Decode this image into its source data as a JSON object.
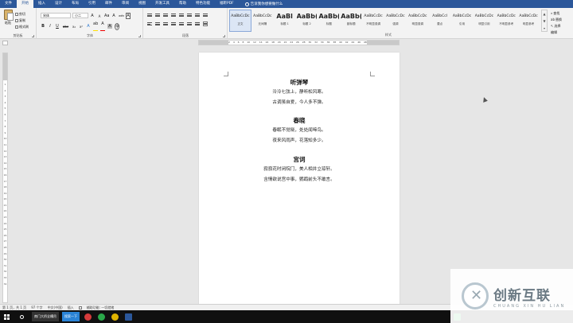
{
  "tabs": [
    "文件",
    "开始",
    "插入",
    "设计",
    "布局",
    "引用",
    "邮件",
    "审阅",
    "视图",
    "开发工具",
    "帮助",
    "特色功能",
    "福昕PDF"
  ],
  "active_tab": "开始",
  "tell_me": "告诉我你想要做什么",
  "clipboard": {
    "paste": "粘贴",
    "cut": "剪切",
    "copy": "复制",
    "format_painter": "格式刷",
    "label": "剪贴板"
  },
  "font": {
    "name": "宋体",
    "size": "小二",
    "grow": "A",
    "shrink": "A",
    "case": "Aa",
    "clear": "A",
    "phonetic": "wén",
    "border": "A",
    "bold": "B",
    "italic": "I",
    "underline": "U",
    "strike": "abc",
    "sub": "x₂",
    "sup": "x²",
    "effects": "A",
    "highlight": "ab",
    "color": "A",
    "char_shade": "A",
    "enclose": "字",
    "label": "字体"
  },
  "paragraph": {
    "label": "段落"
  },
  "styles": {
    "label": "样式",
    "items": [
      {
        "preview": "AaBbCcDc",
        "name": "正文",
        "selected": true
      },
      {
        "preview": "AaBbCcDc",
        "name": "无间隔",
        "selected": false
      },
      {
        "preview": "AaBl",
        "name": "标题 1",
        "selected": false
      },
      {
        "preview": "AaBb(",
        "name": "标题 2",
        "selected": false
      },
      {
        "preview": "AaBb(",
        "name": "标题",
        "selected": false
      },
      {
        "preview": "AaBb(",
        "name": "副标题",
        "selected": false
      },
      {
        "preview": "AaBbCcDc",
        "name": "不明显强调",
        "selected": false
      },
      {
        "preview": "AaBbCcDc",
        "name": "强调",
        "selected": false
      },
      {
        "preview": "AaBbCcDc",
        "name": "明显强调",
        "selected": false
      },
      {
        "preview": "AaBbCcI",
        "name": "要点",
        "selected": false
      },
      {
        "preview": "AaBbCcDc",
        "name": "引用",
        "selected": false
      },
      {
        "preview": "AaBbCcDc",
        "name": "明显引用",
        "selected": false
      },
      {
        "preview": "AaBbCcDc",
        "name": "不明显参考",
        "selected": false
      },
      {
        "preview": "AaBbCcDc",
        "name": "明显参考",
        "selected": false
      }
    ]
  },
  "editing": {
    "find": "查找",
    "replace": "替换",
    "select": "选择",
    "label": "编辑"
  },
  "ruler_ticks": [
    "2",
    "4",
    "6",
    "8",
    "10",
    "12",
    "14",
    "16",
    "18",
    "20",
    "22",
    "24",
    "26",
    "28",
    "30",
    "32",
    "34",
    "36",
    "38",
    "40",
    "42",
    "44",
    "46",
    "48"
  ],
  "vruler_nums": [
    "1",
    "2",
    "3",
    "4",
    "5",
    "6",
    "7",
    "8",
    "9",
    "10",
    "11",
    "12",
    "13",
    "14",
    "15",
    "16",
    "17",
    "18",
    "19",
    "20",
    "21",
    "22",
    "23",
    "24",
    "25",
    "26",
    "27",
    "28",
    "29",
    "30",
    "31",
    "32",
    "33",
    "34"
  ],
  "poems": [
    {
      "title": "听弹琴",
      "lines": [
        "泠泠七弦上，静听松风寒。",
        "古调虽自爱，今人多不弹。"
      ]
    },
    {
      "title": "春晓",
      "lines": [
        "春眠不觉晓，处处闻啼鸟。",
        "夜来风雨声，花落知多少。"
      ]
    },
    {
      "title": "宫词",
      "lines": [
        "寂寂花时闭院门，美人相并立琼轩。",
        "含情欲说宫中事，鹦鹉前头不敢言。"
      ]
    }
  ],
  "status": {
    "page": "第 1 页，共 1 页",
    "words": "97 个字",
    "lang": "中文(中国)",
    "insert": "插入",
    "accessibility": "辅助功能: 一切就绪"
  },
  "taskbar": {
    "app1": "南门大桥全槽吊",
    "app2": "搜索一下"
  },
  "watermark": {
    "cn": "创新互联",
    "en": "CHUANG XIN HU LIAN"
  },
  "colors": {
    "ribbon_blue": "#2b579a",
    "highlight": "#ffde00",
    "font_red": "#e00000"
  }
}
